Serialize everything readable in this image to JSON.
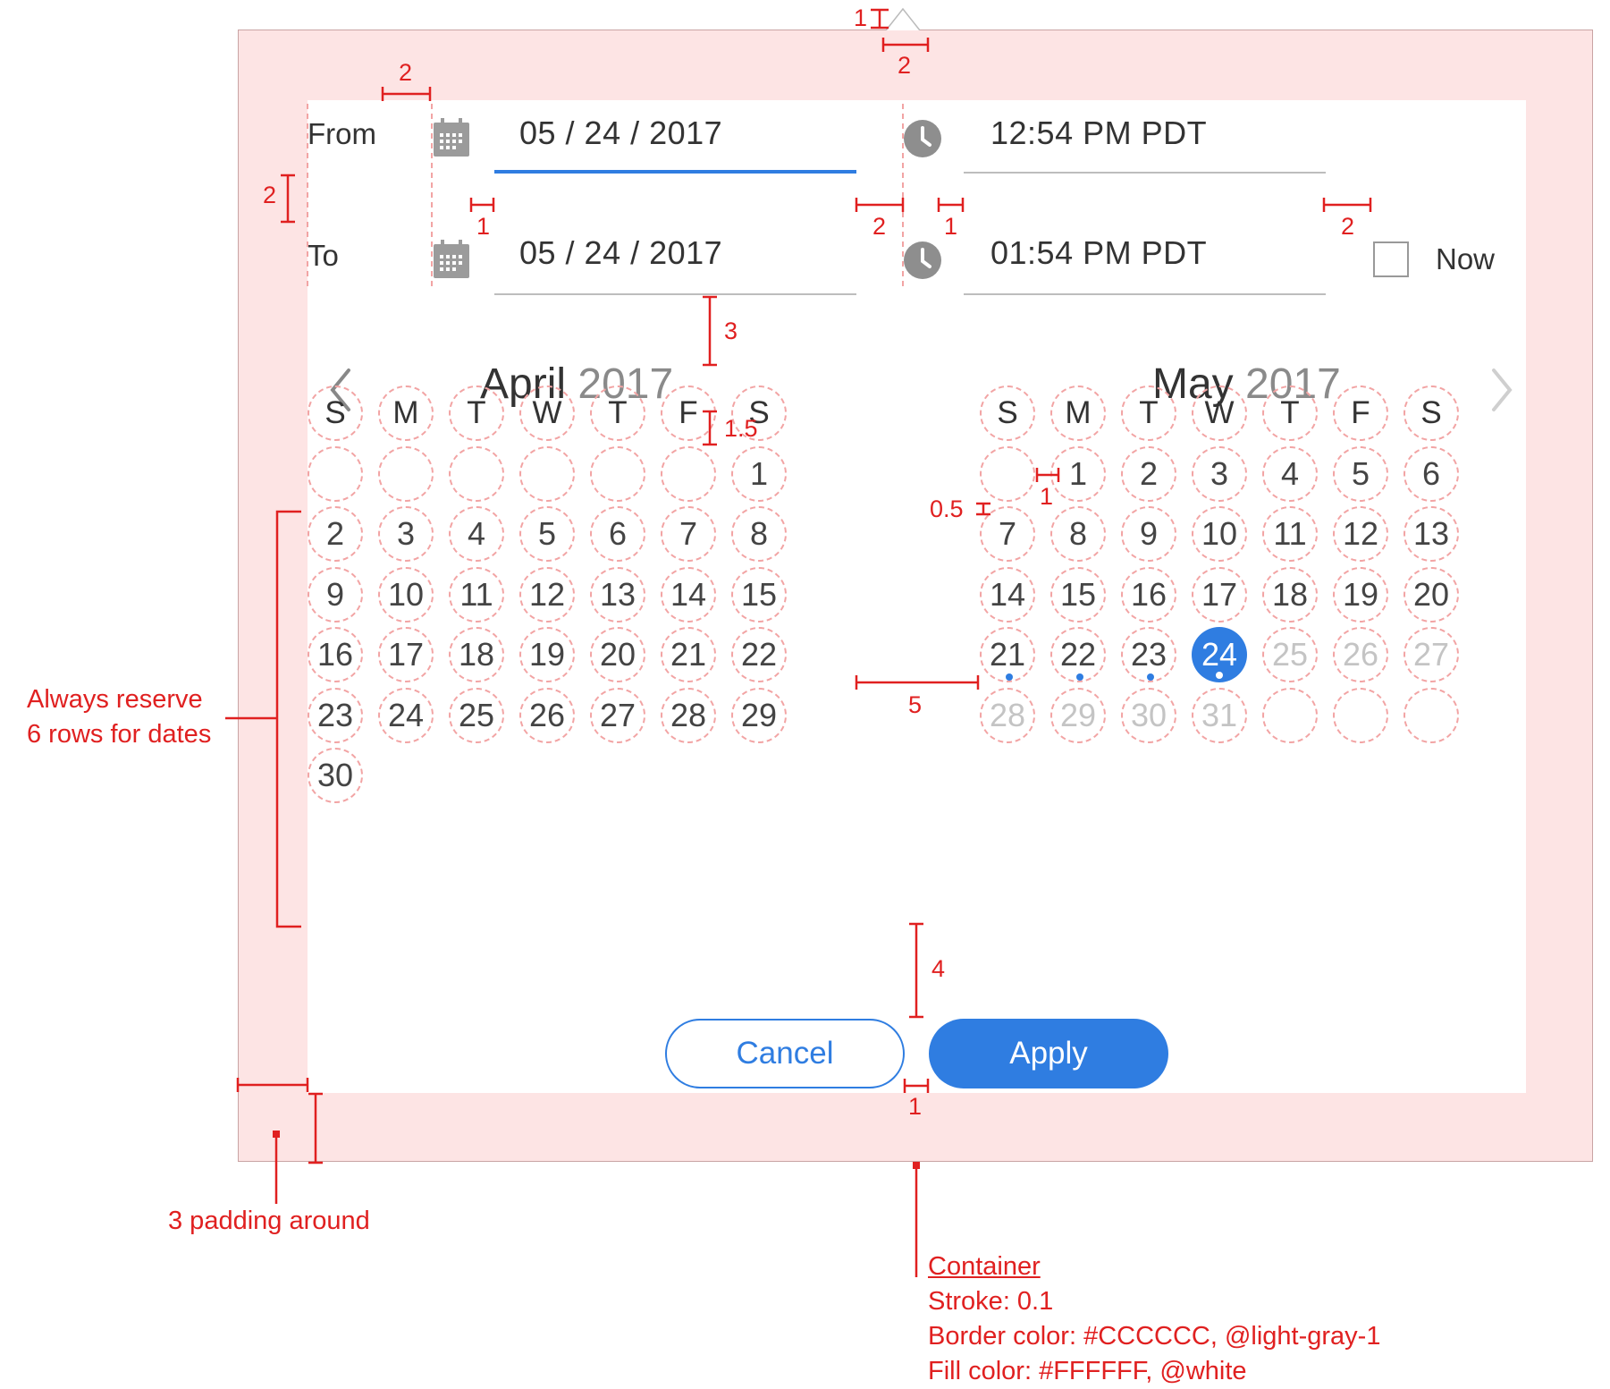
{
  "picker": {
    "from_label": "From",
    "to_label": "To",
    "from_date": "05 / 24 / 2017",
    "from_time": "12:54 PM PDT",
    "to_date": "05 / 24 / 2017",
    "to_time": "01:54 PM PDT",
    "now_label": "Now",
    "now_checked": false,
    "accent_color": "#2f7de1"
  },
  "calendar": {
    "weekdays": [
      "S",
      "M",
      "T",
      "W",
      "T",
      "F",
      "S"
    ],
    "left": {
      "month": "April",
      "year": "2017",
      "rows": [
        [
          "",
          "",
          "",
          "",
          "",
          "",
          "1"
        ],
        [
          "2",
          "3",
          "4",
          "5",
          "6",
          "7",
          "8"
        ],
        [
          "9",
          "10",
          "11",
          "12",
          "13",
          "14",
          "15"
        ],
        [
          "16",
          "17",
          "18",
          "19",
          "20",
          "21",
          "22"
        ],
        [
          "23",
          "24",
          "25",
          "26",
          "27",
          "28",
          "29"
        ],
        [
          "30"
        ]
      ]
    },
    "right": {
      "month": "May",
      "year": "2017",
      "rows": [
        [
          "",
          "1",
          "2",
          "3",
          "4",
          "5",
          "6"
        ],
        [
          "7",
          "8",
          "9",
          "10",
          "11",
          "12",
          "13"
        ],
        [
          "14",
          "15",
          "16",
          "17",
          "18",
          "19",
          "20"
        ],
        [
          "21",
          "22",
          "23",
          "24",
          "25",
          "26",
          "27"
        ],
        [
          "28",
          "29",
          "30",
          "31",
          "",
          "",
          ""
        ]
      ],
      "selected_day": "24",
      "dotted_days": [
        "21",
        "22",
        "23",
        "24"
      ],
      "muted_days": [
        "25",
        "26",
        "27",
        "28",
        "29",
        "30",
        "31"
      ]
    },
    "prev_icon": "chevron-left-icon",
    "next_icon": "chevron-right-icon"
  },
  "buttons": {
    "cancel": "Cancel",
    "apply": "Apply"
  },
  "annotations": {
    "caret_gap": "1",
    "caret_offset": "2",
    "label_gap": "2",
    "row_gap": "2",
    "icon_gap_from": "1",
    "field_gap": "2",
    "clock_gap": "1",
    "time_gap": "2",
    "header_gap": "3",
    "title_gap": "1.5",
    "cell_gap_h": "1",
    "cell_gap_v": "0.5",
    "month_gap": "5",
    "footer_gap": "4",
    "button_gap": "1",
    "reserve_rows": "Always reserve\n6 rows for dates",
    "padding_note": "3 padding around",
    "container_title": "Container",
    "container_stroke": "Stroke: 0.1",
    "container_border": "Border color: #CCCCCC, @light-gray-1",
    "container_fill": "Fill color: #FFFFFF, @white"
  },
  "colors": {
    "annotation": "#e02020",
    "frame_fill": "#fde4e4",
    "dashed_guide": "#f2a4a4"
  }
}
